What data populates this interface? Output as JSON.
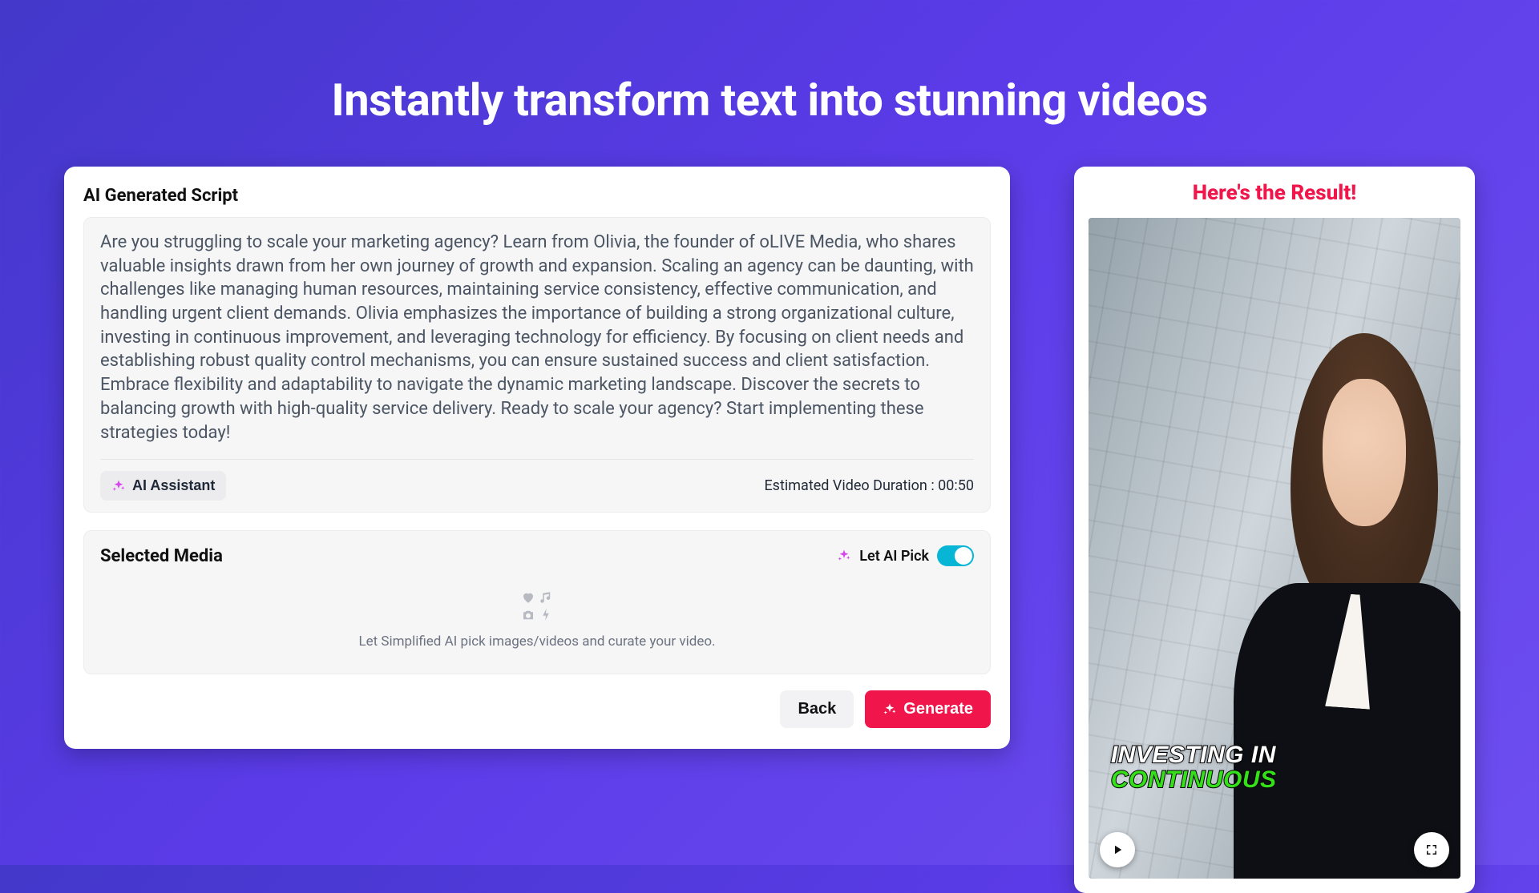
{
  "page": {
    "headline": "Instantly transform text into stunning videos"
  },
  "script_card": {
    "heading": "AI Generated Script",
    "body": "Are you struggling to scale your marketing agency? Learn from Olivia, the founder of oLIVE Media, who shares valuable insights drawn from her own journey of growth and expansion. Scaling an agency can be daunting, with challenges like managing human resources, maintaining service consistency, effective communication, and handling urgent client demands. Olivia emphasizes the importance of building a strong organizational culture, investing in continuous improvement, and leveraging technology for efficiency. By focusing on client needs and establishing robust quality control mechanisms, you can ensure sustained success and client satisfaction. Embrace flexibility and adaptability to navigate the dynamic marketing landscape. Discover the secrets to balancing growth with high-quality service delivery. Ready to scale your agency? Start implementing these strategies today!",
    "ai_assistant_label": "AI Assistant",
    "estimated_duration_label": "Estimated Video Duration : 00:50"
  },
  "media": {
    "heading": "Selected Media",
    "let_ai_pick_label": "Let AI Pick",
    "toggle_on": true,
    "hint": "Let Simplified AI pick images/videos and curate your video."
  },
  "actions": {
    "back_label": "Back",
    "generate_label": "Generate"
  },
  "result": {
    "title": "Here's the Result!",
    "caption_line1": "INVESTING IN",
    "caption_line2": "CONTINUOUS"
  }
}
